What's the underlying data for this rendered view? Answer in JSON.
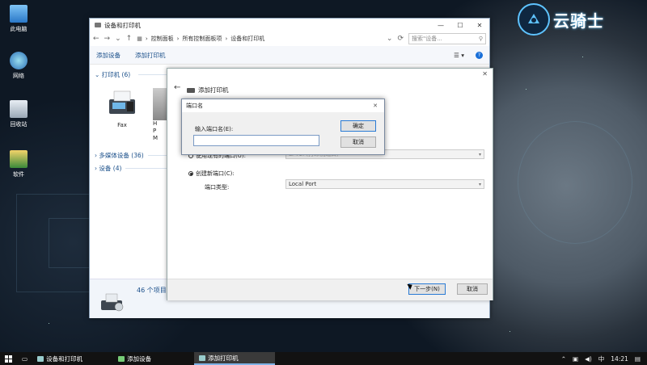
{
  "desktop": {
    "icons": [
      {
        "label": "此电脑",
        "icon": "computer-icon"
      },
      {
        "label": "网络",
        "icon": "network-icon"
      },
      {
        "label": "回收站",
        "icon": "recycle-bin-icon"
      },
      {
        "label": "软件",
        "icon": "folder-icon"
      }
    ],
    "logo_text": "云骑士"
  },
  "explorer": {
    "title": "设备和打印机",
    "breadcrumb": [
      "控制面板",
      "所有控制面板项",
      "设备和打印机"
    ],
    "search_placeholder": "搜索\"设备...",
    "toolbar": {
      "add_device": "添加设备",
      "add_printer": "添加打印机"
    },
    "groups": {
      "printers": "打印机 (6)",
      "multimedia": "多媒体设备 (36)",
      "devices": "设备 (4)"
    },
    "devices": [
      {
        "label": "Fax"
      },
      {
        "label": "H\nP\nM"
      }
    ],
    "status_count": "46 个项目"
  },
  "wizard": {
    "title": "添加打印机",
    "option_existing": "使用现有的端口(U):",
    "option_existing_value": "LPT1: (打印机端口)",
    "option_new": "创建新端口(C):",
    "port_type_label": "端口类型:",
    "port_type_value": "Local Port",
    "next_button": "下一步(N)",
    "cancel_button": "取消"
  },
  "dialog": {
    "title": "端口名",
    "prompt": "输入端口名(E):",
    "input_value": "",
    "ok": "确定",
    "cancel": "取消"
  },
  "taskbar": {
    "items": [
      {
        "label": "设备和打印机",
        "active": false
      },
      {
        "label": "添加设备",
        "active": false
      },
      {
        "label": "添加打印机",
        "active": true
      }
    ],
    "ime": "中",
    "time": "14:21"
  }
}
